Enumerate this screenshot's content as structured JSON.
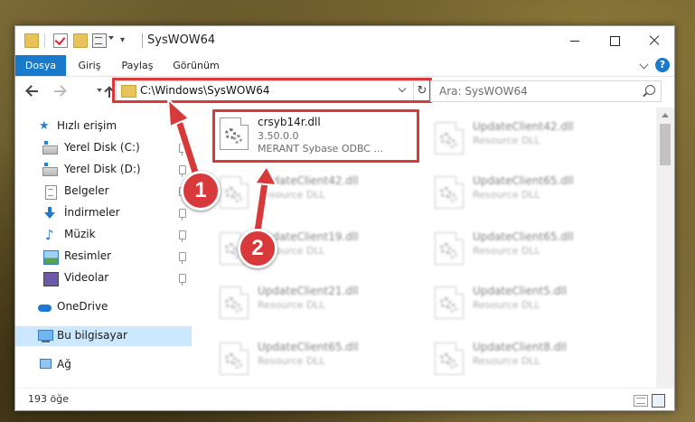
{
  "window": {
    "title": "SysWOW64"
  },
  "ribbon": {
    "tabs": [
      "Dosya",
      "Giriş",
      "Paylaş",
      "Görünüm"
    ],
    "help": "?"
  },
  "address": {
    "path": "C:\\Windows\\SysWOW64",
    "refresh_icon": "↻"
  },
  "search": {
    "placeholder": "Ara: SysWOW64"
  },
  "sidebar": {
    "items": [
      {
        "label": "Hızlı erişim",
        "icon": "star-icon"
      },
      {
        "label": "Yerel Disk (C:)",
        "icon": "drive-icon"
      },
      {
        "label": "Yerel Disk (D:)",
        "icon": "drive-icon"
      },
      {
        "label": "Belgeler",
        "icon": "documents-icon"
      },
      {
        "label": "İndirmeler",
        "icon": "downloads-icon"
      },
      {
        "label": "Müzik",
        "icon": "music-icon"
      },
      {
        "label": "Resimler",
        "icon": "pictures-icon"
      },
      {
        "label": "Videolar",
        "icon": "videos-icon"
      },
      {
        "label": "OneDrive",
        "icon": "cloud-icon"
      },
      {
        "label": "Bu bilgisayar",
        "icon": "computer-icon"
      },
      {
        "label": "Ağ",
        "icon": "network-icon"
      }
    ]
  },
  "files": {
    "highlighted": {
      "name": "crsyb14r.dll",
      "version": "3.50.0.0",
      "description": "MERANT Sybase ODBC ..."
    },
    "left_column": [
      {
        "name": "UpdateClient42.dll",
        "description": "Resource DLL"
      },
      {
        "name": "UpdateClient19.dll",
        "description": "Resource DLL"
      },
      {
        "name": "UpdateClient21.dll",
        "description": "Resource DLL"
      },
      {
        "name": "UpdateClient65.dll",
        "description": "Resource DLL"
      }
    ],
    "right_column": [
      {
        "name": "UpdateClient42.dll",
        "description": "Resource DLL"
      },
      {
        "name": "UpdateClient65.dll",
        "description": "Resource DLL"
      },
      {
        "name": "UpdateClient65.dll",
        "description": "Resource DLL"
      },
      {
        "name": "UpdateClient5.dll",
        "description": "Resource DLL"
      },
      {
        "name": "UpdateClient8.dll",
        "description": "Resource DLL"
      }
    ]
  },
  "status": {
    "count": "193 öğe"
  },
  "annotations": {
    "badge1": "1",
    "badge2": "2",
    "color": "#d8393a"
  }
}
